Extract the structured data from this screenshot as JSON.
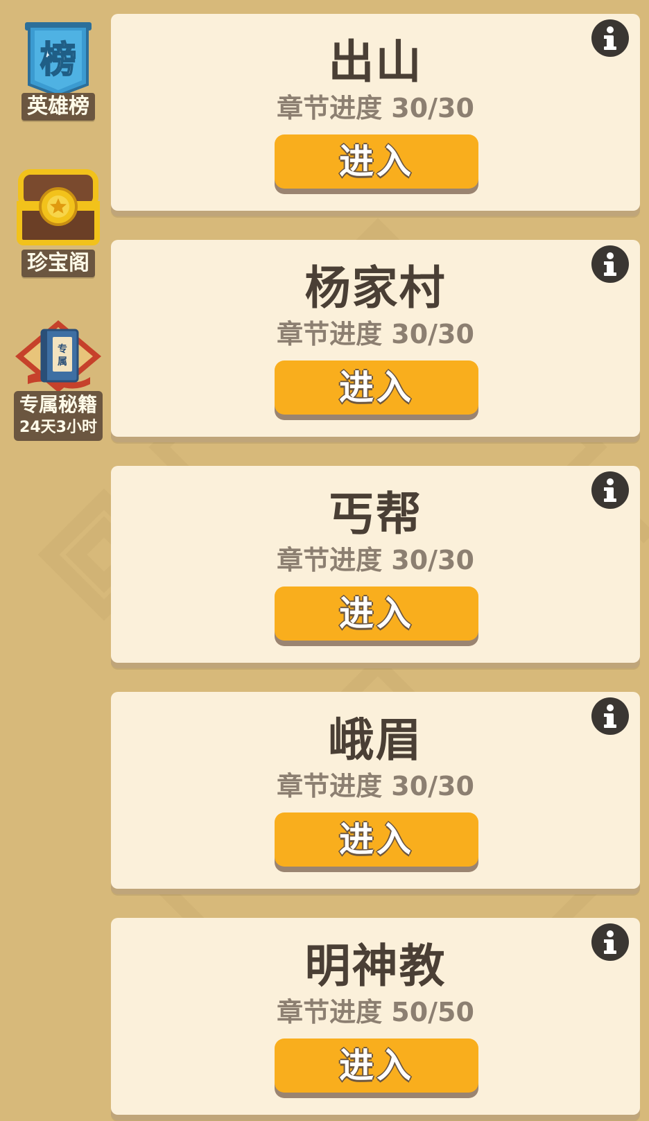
{
  "sidebar": {
    "items": [
      {
        "label": "英雄榜",
        "icon": "leaderboard-banner-icon",
        "icon_text": "榜"
      },
      {
        "label": "珍宝阁",
        "icon": "treasure-chest-icon"
      },
      {
        "label": "专属秘籍",
        "sub": "24天3小时",
        "icon": "exclusive-book-icon",
        "icon_text": "专属"
      }
    ]
  },
  "chapters": [
    {
      "title": "出山",
      "progress": "章节进度 30/30",
      "button": "进入"
    },
    {
      "title": "杨家村",
      "progress": "章节进度 30/30",
      "button": "进入"
    },
    {
      "title": "丐帮",
      "progress": "章节进度 30/30",
      "button": "进入"
    },
    {
      "title": "峨眉",
      "progress": "章节进度 30/30",
      "button": "进入"
    },
    {
      "title": "明神教",
      "progress": "章节进度 50/50",
      "button": "进入"
    }
  ],
  "colors": {
    "background": "#d7b97a",
    "card": "#fbf0da",
    "button": "#f9ae1d",
    "title_text": "#4a3f35",
    "progress_text": "#8c7f71",
    "label_bg": "#6b5640"
  }
}
